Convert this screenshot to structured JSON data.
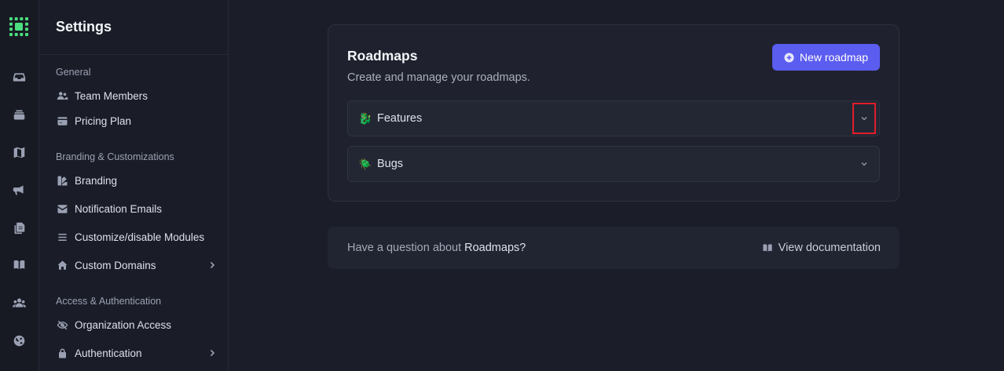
{
  "rail": {
    "icons": [
      "logo-icon",
      "inbox-icon",
      "layers-icon",
      "map-icon",
      "megaphone-icon",
      "documents-icon",
      "book-icon",
      "users-icon",
      "globe-icon"
    ],
    "logo_color": "#4ade80"
  },
  "sidebar": {
    "title": "Settings",
    "sections": [
      {
        "label": "General",
        "items": [
          {
            "label": "Team Members"
          },
          {
            "label": "Pricing Plan"
          }
        ]
      },
      {
        "label": "Branding & Customizations",
        "items": [
          {
            "label": "Branding"
          },
          {
            "label": "Notification Emails"
          },
          {
            "label": "Customize/disable Modules"
          },
          {
            "label": "Custom Domains"
          }
        ]
      },
      {
        "label": "Access & Authentication",
        "items": [
          {
            "label": "Organization Access"
          },
          {
            "label": "Authentication"
          }
        ]
      }
    ]
  },
  "main": {
    "card": {
      "title": "Roadmaps",
      "subtitle": "Create and manage your roadmaps.",
      "new_button": "New roadmap",
      "roadmaps": [
        {
          "emoji": "🐉",
          "name": "Features"
        },
        {
          "emoji": "🪲",
          "name": "Bugs"
        }
      ]
    },
    "help": {
      "question_prefix": "Have a question about ",
      "question_topic": "Roadmaps?",
      "doc_link": "View documentation"
    }
  },
  "colors": {
    "accent": "#5b5cf0",
    "highlight": "#e11d2a",
    "background": "#1b1e29"
  }
}
